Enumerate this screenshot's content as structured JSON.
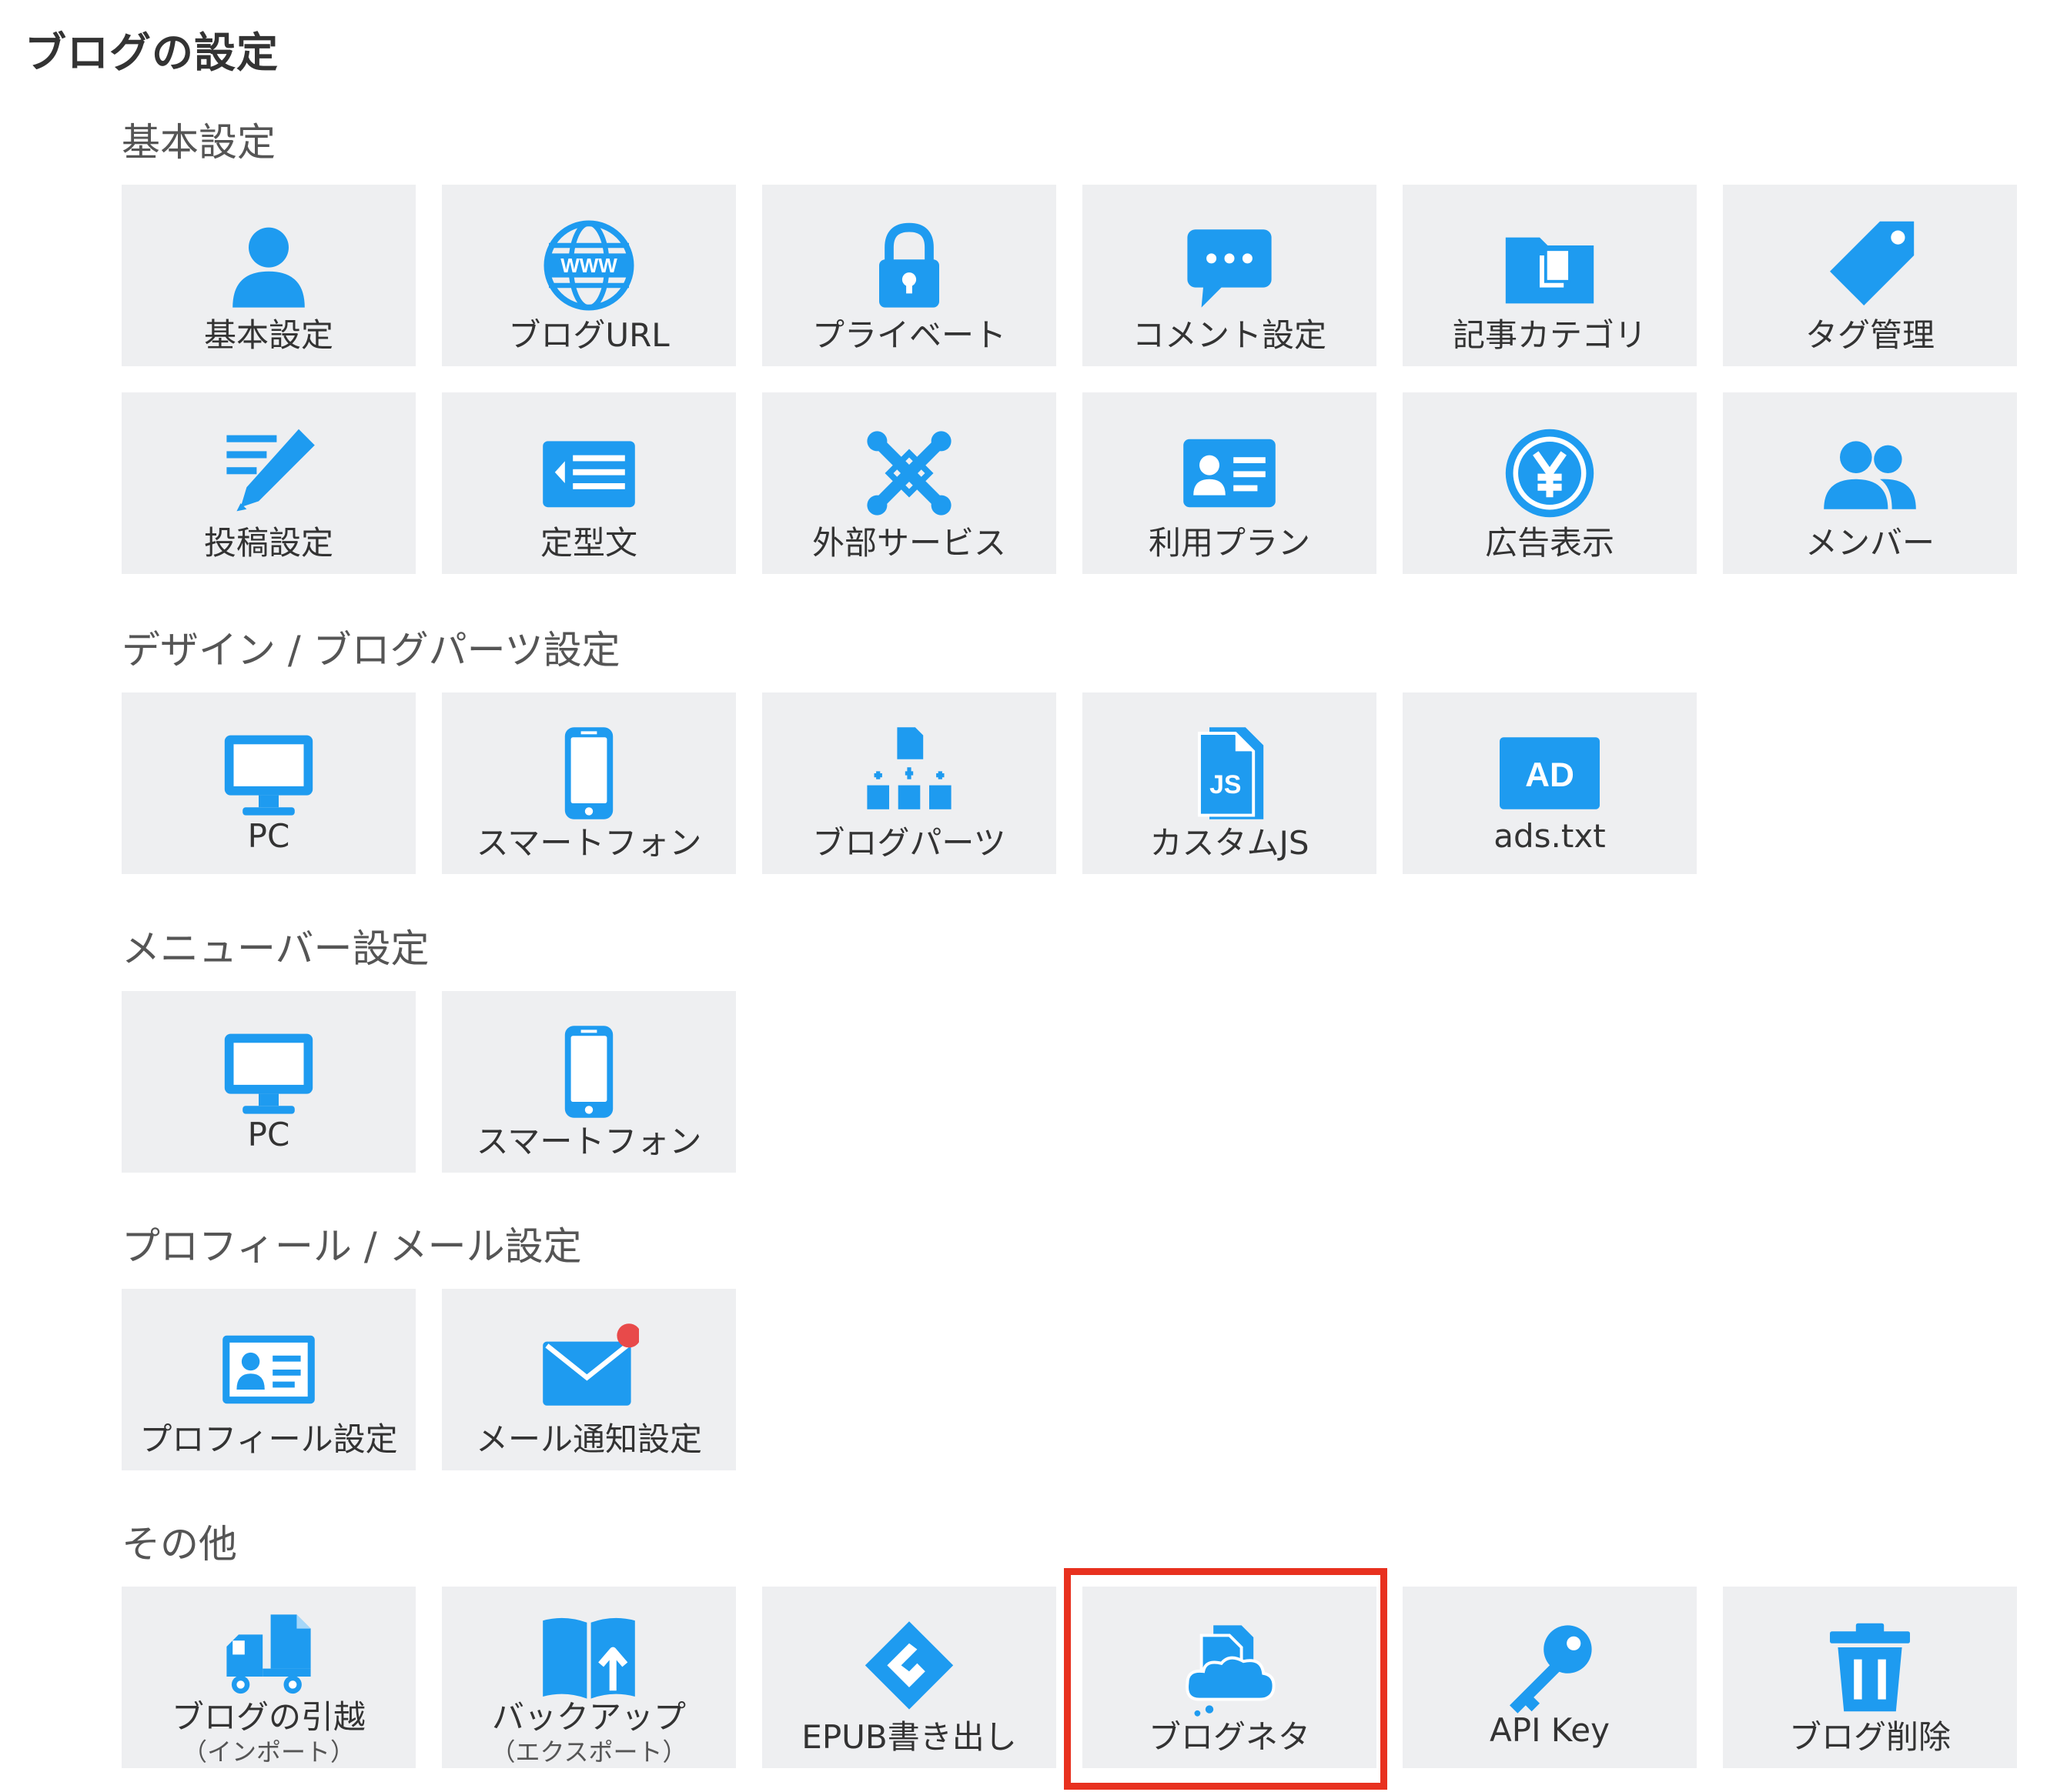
{
  "page_title": "ブログの設定",
  "colors": {
    "icon": "#1e9bf0",
    "tile_bg": "#eeeff1",
    "highlight": "#e8311f",
    "badge": "#e84a4a"
  },
  "sections": {
    "basic": {
      "title": "基本設定",
      "tiles": [
        {
          "label": "基本設定",
          "icon": "person-icon"
        },
        {
          "label": "ブログURL",
          "icon": "www-globe-icon"
        },
        {
          "label": "プライベート",
          "icon": "lock-icon"
        },
        {
          "label": "コメント設定",
          "icon": "comment-bubble-icon"
        },
        {
          "label": "記事カテゴリ",
          "icon": "folder-icon"
        },
        {
          "label": "タグ管理",
          "icon": "tag-icon"
        },
        {
          "label": "投稿設定",
          "icon": "pencil-icon"
        },
        {
          "label": "定型文",
          "icon": "template-text-icon"
        },
        {
          "label": "外部サービス",
          "icon": "external-service-icon"
        },
        {
          "label": "利用プラン",
          "icon": "id-card-icon"
        },
        {
          "label": "広告表示",
          "icon": "yen-circle-icon"
        },
        {
          "label": "メンバー",
          "icon": "members-icon"
        }
      ]
    },
    "design": {
      "title": "デザイン / ブログパーツ設定",
      "tiles": [
        {
          "label": "PC",
          "icon": "monitor-icon"
        },
        {
          "label": "スマートフォン",
          "icon": "smartphone-icon"
        },
        {
          "label": "ブログパーツ",
          "icon": "blog-parts-icon"
        },
        {
          "label": "カスタムJS",
          "icon": "js-file-icon"
        },
        {
          "label": "ads.txt",
          "icon": "ad-badge-icon",
          "icon_text": "AD"
        }
      ]
    },
    "menubar": {
      "title": "メニューバー設定",
      "tiles": [
        {
          "label": "PC",
          "icon": "monitor-icon"
        },
        {
          "label": "スマートフォン",
          "icon": "smartphone-icon"
        }
      ]
    },
    "profile": {
      "title": "プロフィール / メール設定",
      "tiles": [
        {
          "label": "プロフィール設定",
          "icon": "profile-card-icon"
        },
        {
          "label": "メール通知設定",
          "icon": "mail-notification-icon"
        }
      ]
    },
    "other": {
      "title": "その他",
      "tiles": [
        {
          "label": "ブログの引越",
          "sub": "（インポート）",
          "icon": "moving-truck-icon"
        },
        {
          "label": "バックアップ",
          "sub": "（エクスポート）",
          "icon": "backup-book-icon"
        },
        {
          "label": "EPUB書き出し",
          "icon": "epub-icon"
        },
        {
          "label": "ブログネタ",
          "icon": "blog-neta-icon"
        },
        {
          "label": "API Key",
          "icon": "key-icon"
        },
        {
          "label": "ブログ削除",
          "icon": "trash-icon"
        }
      ]
    }
  }
}
